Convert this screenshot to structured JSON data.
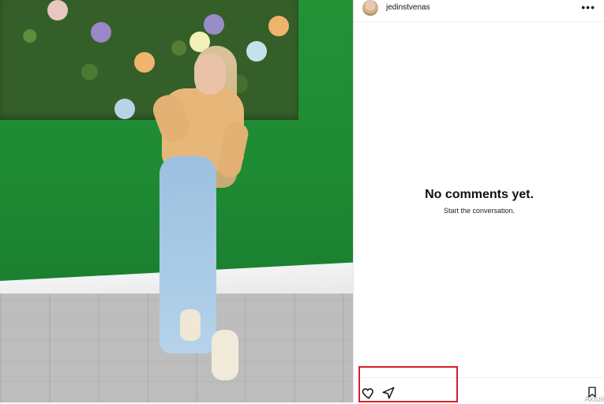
{
  "post": {
    "username": "jedinstvenas",
    "more_label": "•••"
  },
  "comments": {
    "empty_title": "No comments yet.",
    "empty_subtitle": "Start the conversation."
  },
  "actions": {
    "icons": [
      "heart-icon",
      "share-icon",
      "bookmark-icon"
    ]
  },
  "footer_text": "Aktuir"
}
